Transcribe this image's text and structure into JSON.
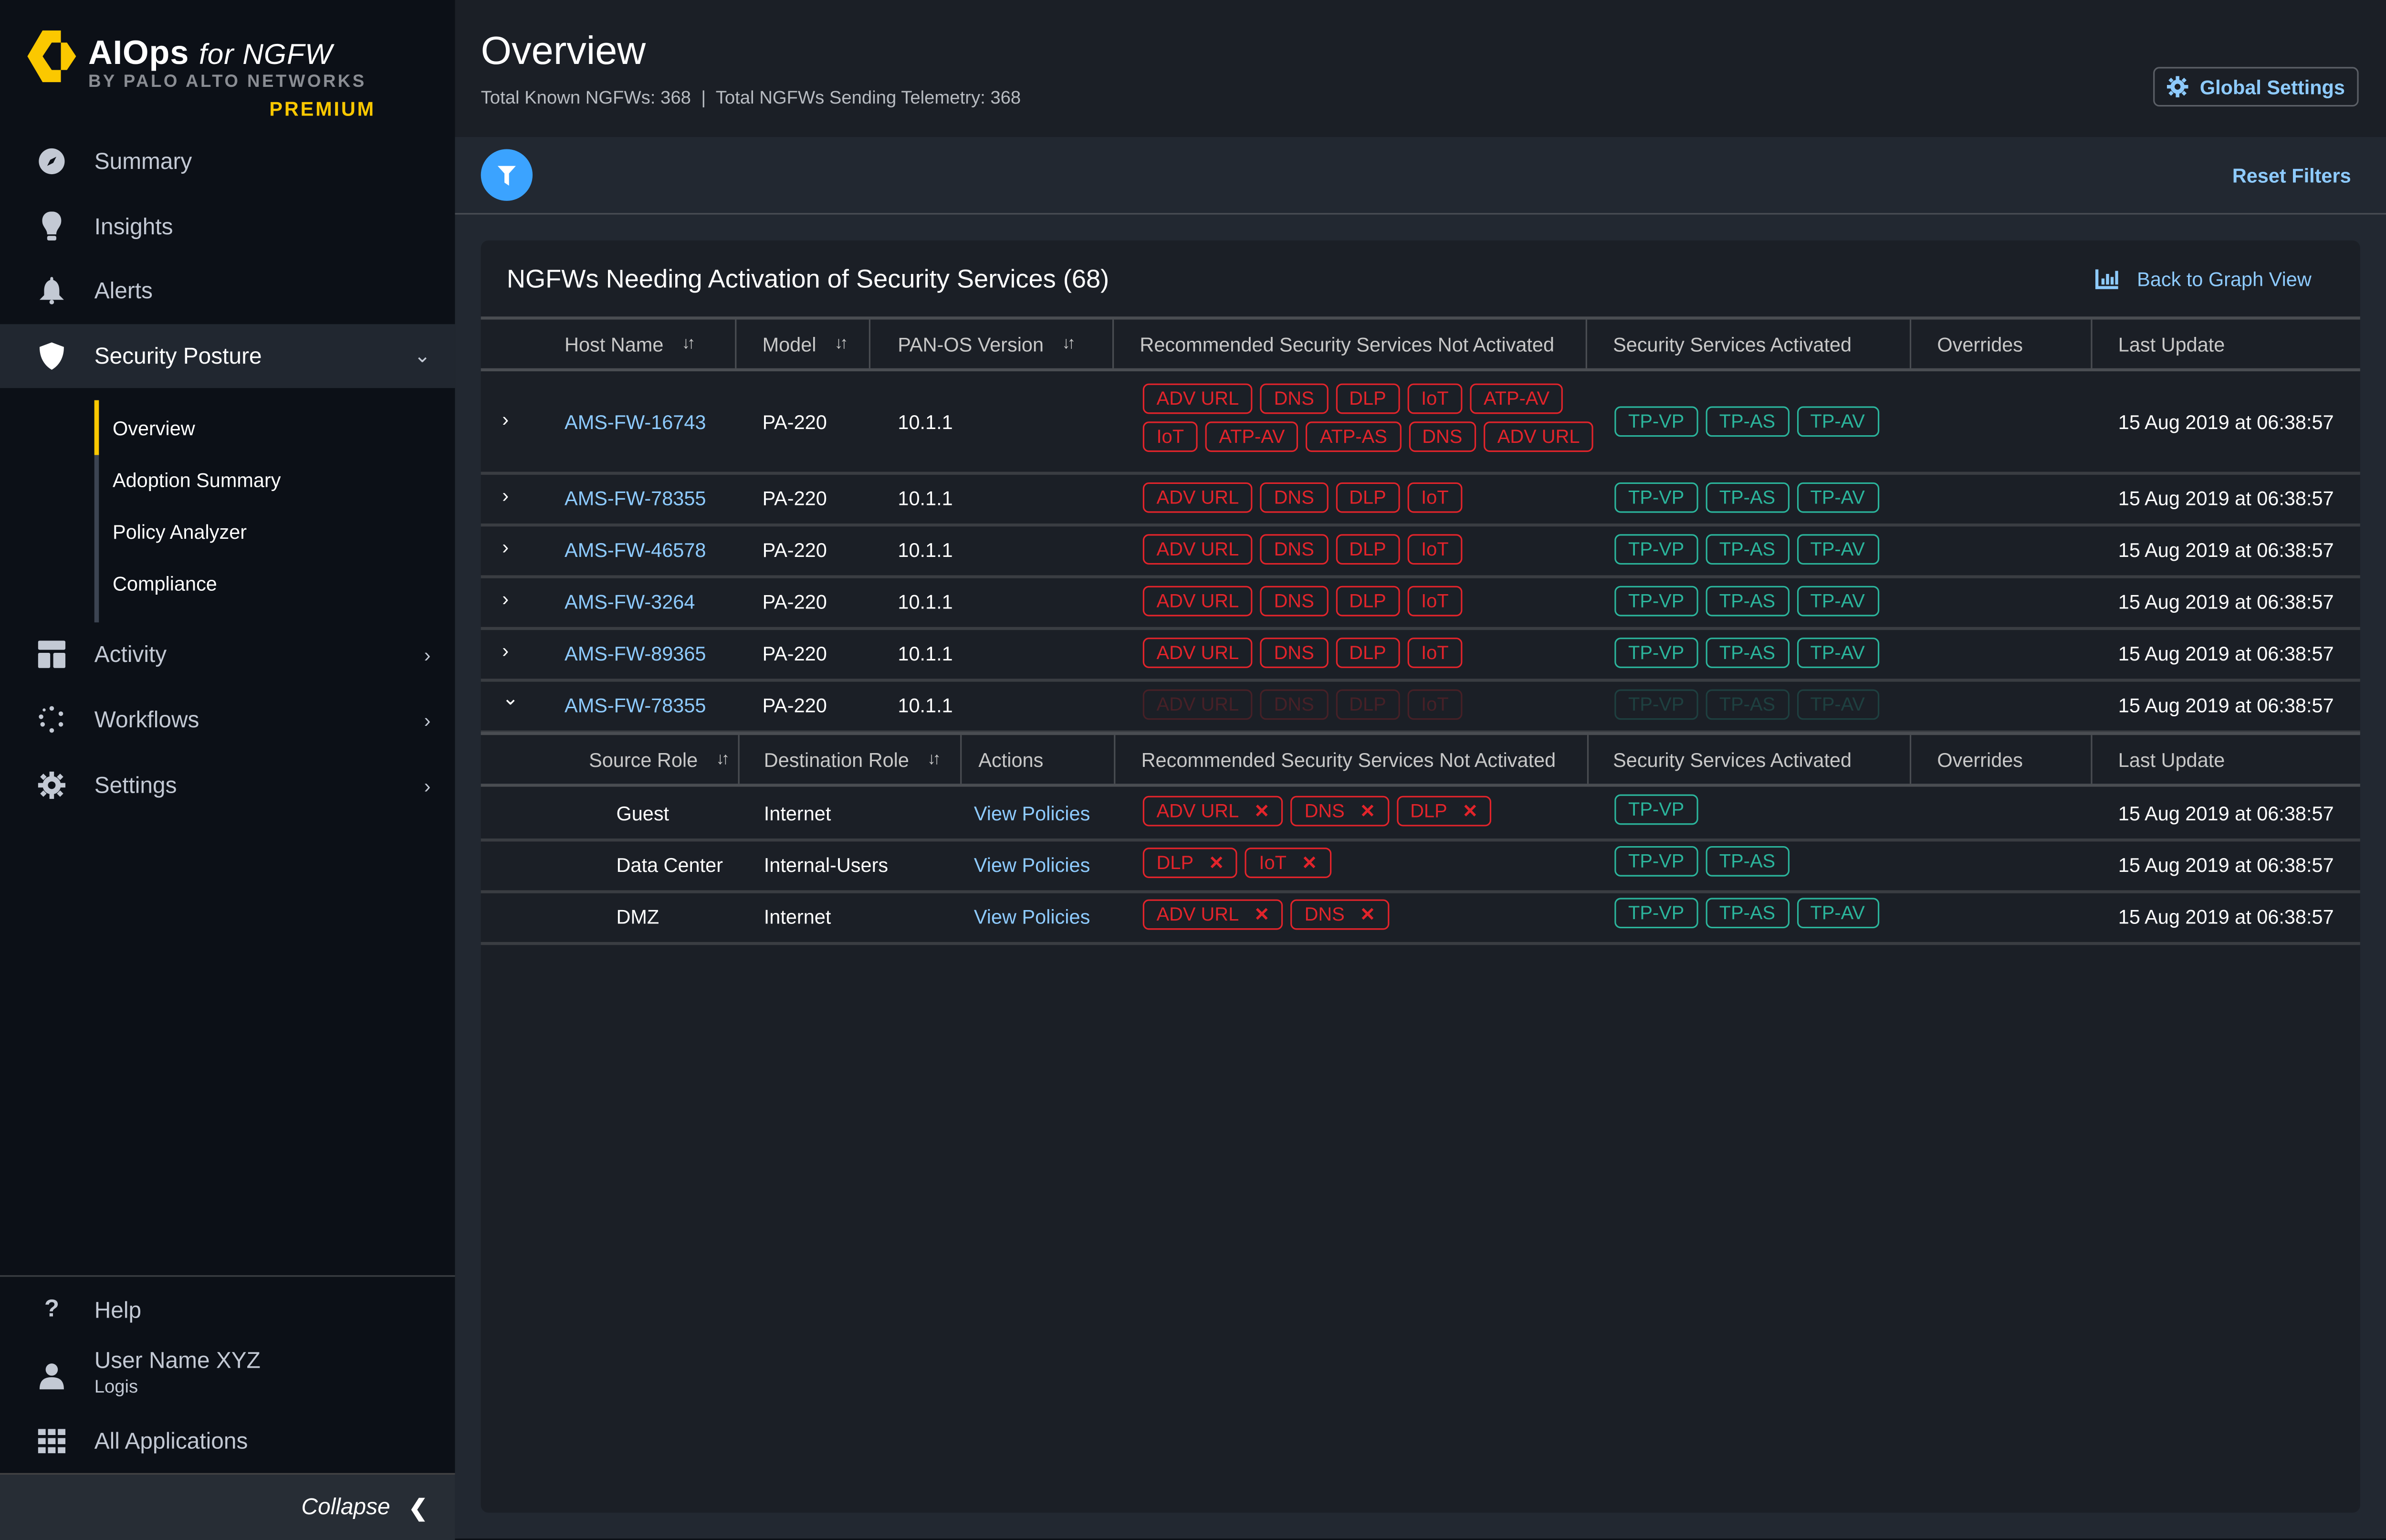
{
  "brand": {
    "product": "AIOps",
    "product_suffix": "for NGFW",
    "byline": "BY PALO ALTO NETWORKS",
    "tier": "PREMIUM",
    "accent_color": "#fbc800"
  },
  "sidebar": {
    "items": [
      {
        "label": "Summary",
        "icon": "compass-icon"
      },
      {
        "label": "Insights",
        "icon": "lightbulb-icon"
      },
      {
        "label": "Alerts",
        "icon": "bell-icon"
      },
      {
        "label": "Security Posture",
        "icon": "shield-icon",
        "active": true,
        "expanded": true
      },
      {
        "label": "Activity",
        "icon": "layout-icon"
      },
      {
        "label": "Workflows",
        "icon": "workflow-icon"
      },
      {
        "label": "Settings",
        "icon": "gear-icon"
      }
    ],
    "subitems": [
      {
        "label": "Overview",
        "active": true
      },
      {
        "label": "Adoption Summary"
      },
      {
        "label": "Policy Analyzer"
      },
      {
        "label": "Compliance"
      }
    ],
    "bottom": {
      "help": "Help",
      "user_name": "User Name XYZ",
      "user_org": "Logis",
      "all_apps": "All Applications",
      "collapse": "Collapse"
    }
  },
  "header": {
    "title": "Overview",
    "subtitle_left": "Total Known NGFWs: 368",
    "subtitle_sep": "|",
    "subtitle_right": "Total NGFWs Sending Telemetry: 368",
    "global_settings": "Global Settings"
  },
  "filters": {
    "reset_label": "Reset Filters"
  },
  "card": {
    "title": "NGFWs Needing Activation of Security Services (68)",
    "graph_link": "Back to Graph View",
    "columns": [
      "Host Name",
      "Model",
      "PAN-OS Version",
      "Recommended Security Services Not Activated",
      "Security Services Activated",
      "Overrides",
      "Last Update"
    ],
    "rows": [
      {
        "host": "AMS-FW-16743",
        "model": "PA-220",
        "version": "10.1.1",
        "not_activated": [
          "ADV URL",
          "DNS",
          "DLP",
          "IoT",
          "ATP-AV",
          "IoT",
          "ATP-AV",
          "ATP-AS",
          "DNS",
          "ADV URL"
        ],
        "activated": [
          "TP-VP",
          "TP-AS",
          "TP-AV"
        ],
        "overrides": "",
        "last_update": "15 Aug 2019 at 06:38:57",
        "expanded": false
      },
      {
        "host": "AMS-FW-78355",
        "model": "PA-220",
        "version": "10.1.1",
        "not_activated": [
          "ADV URL",
          "DNS",
          "DLP",
          "IoT"
        ],
        "activated": [
          "TP-VP",
          "TP-AS",
          "TP-AV"
        ],
        "overrides": "",
        "last_update": "15 Aug 2019 at 06:38:57",
        "expanded": false
      },
      {
        "host": "AMS-FW-46578",
        "model": "PA-220",
        "version": "10.1.1",
        "not_activated": [
          "ADV URL",
          "DNS",
          "DLP",
          "IoT"
        ],
        "activated": [
          "TP-VP",
          "TP-AS",
          "TP-AV"
        ],
        "overrides": "",
        "last_update": "15 Aug 2019 at 06:38:57",
        "expanded": false
      },
      {
        "host": "AMS-FW-3264",
        "model": "PA-220",
        "version": "10.1.1",
        "not_activated": [
          "ADV URL",
          "DNS",
          "DLP",
          "IoT"
        ],
        "activated": [
          "TP-VP",
          "TP-AS",
          "TP-AV"
        ],
        "overrides": "",
        "last_update": "15 Aug 2019 at 06:38:57",
        "expanded": false
      },
      {
        "host": "AMS-FW-89365",
        "model": "PA-220",
        "version": "10.1.1",
        "not_activated": [
          "ADV URL",
          "DNS",
          "DLP",
          "IoT"
        ],
        "activated": [
          "TP-VP",
          "TP-AS",
          "TP-AV"
        ],
        "overrides": "",
        "last_update": "15 Aug 2019 at 06:38:57",
        "expanded": false
      },
      {
        "host": "AMS-FW-78355",
        "model": "PA-220",
        "version": "10.1.1",
        "not_activated": [
          "ADV URL",
          "DNS",
          "DLP",
          "IoT"
        ],
        "activated": [
          "TP-VP",
          "TP-AS",
          "TP-AV"
        ],
        "overrides": "",
        "last_update": "15 Aug 2019 at 06:38:57",
        "expanded": true
      }
    ],
    "sub_columns": [
      "Source Role",
      "Destination Role",
      "Actions",
      "Recommended Security Services Not Activated",
      "Security Services Activated",
      "Overrides",
      "Last Update"
    ],
    "sub_rows": [
      {
        "source": "Guest",
        "destination": "Internet",
        "action": "View Policies",
        "not_activated": [
          "ADV URL",
          "DNS",
          "DLP"
        ],
        "activated": [
          "TP-VP"
        ],
        "overrides": "",
        "last_update": "15 Aug 2019 at 06:38:57"
      },
      {
        "source": "Data Center",
        "destination": "Internal-Users",
        "action": "View Policies",
        "not_activated": [
          "DLP",
          "IoT"
        ],
        "activated": [
          "TP-VP",
          "TP-AS"
        ],
        "overrides": "",
        "last_update": "15 Aug 2019 at 06:38:57"
      },
      {
        "source": "DMZ",
        "destination": "Internet",
        "action": "View Policies",
        "not_activated": [
          "ADV URL",
          "DNS"
        ],
        "activated": [
          "TP-VP",
          "TP-AS",
          "TP-AV"
        ],
        "overrides": "",
        "last_update": "15 Aug 2019 at 06:38:57"
      }
    ],
    "colors": {
      "not_activated": "#e3242b",
      "activated": "#2bb59c",
      "link": "#8ecbff"
    }
  }
}
